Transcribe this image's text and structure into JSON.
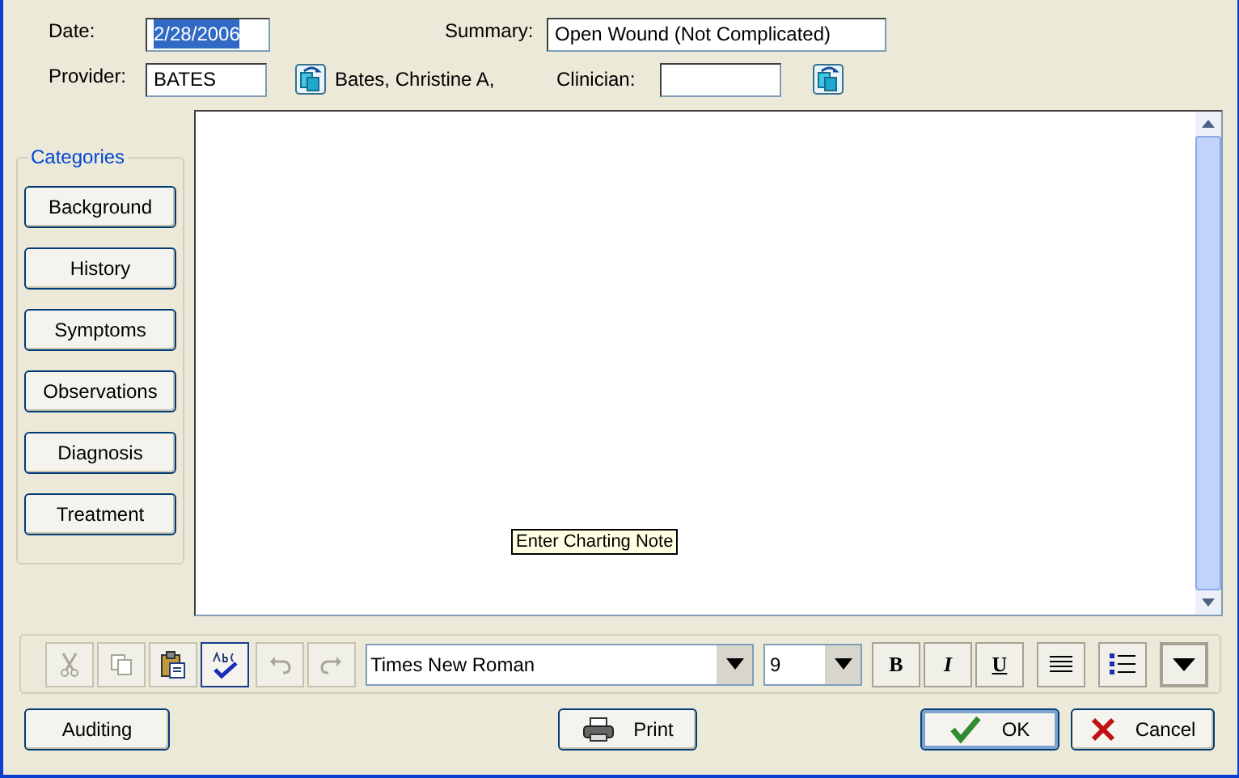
{
  "header": {
    "date": {
      "label": "Date:",
      "value": "2/28/2006",
      "selected": true
    },
    "summary": {
      "label": "Summary:",
      "value": "Open Wound (Not Complicated)"
    },
    "provider": {
      "label": "Provider:",
      "value": "BATES",
      "name": "Bates, Christine A,"
    },
    "clinician": {
      "label": "Clinician:"
    }
  },
  "categories": {
    "title": "Categories",
    "items": [
      "Background",
      "History",
      "Symptoms",
      "Observations",
      "Diagnosis",
      "Treatment"
    ]
  },
  "editor": {
    "tooltip": "Enter Charting Note"
  },
  "toolbar": {
    "tools": [
      {
        "kind": "cut",
        "disabled": true,
        "selected": false
      },
      {
        "kind": "copy",
        "disabled": true,
        "selected": false
      },
      {
        "kind": "paste",
        "disabled": false,
        "selected": false
      },
      {
        "kind": "spell",
        "disabled": false,
        "selected": true
      },
      {
        "kind": "undo",
        "disabled": true,
        "selected": false
      },
      {
        "kind": "redo",
        "disabled": true,
        "selected": false
      }
    ],
    "font": "Times New Roman",
    "size": "9",
    "format": [
      {
        "kind": "bold",
        "label": "B"
      },
      {
        "kind": "italic",
        "label": "I"
      },
      {
        "kind": "underline",
        "label": "U"
      },
      {
        "kind": "align"
      },
      {
        "kind": "list"
      },
      {
        "kind": "more"
      }
    ]
  },
  "buttons": [
    {
      "kind": "auditing",
      "label": "Auditing"
    },
    {
      "kind": "print",
      "label": "Print"
    },
    {
      "kind": "ok",
      "label": "OK"
    },
    {
      "kind": "cancel",
      "label": "Cancel"
    }
  ]
}
